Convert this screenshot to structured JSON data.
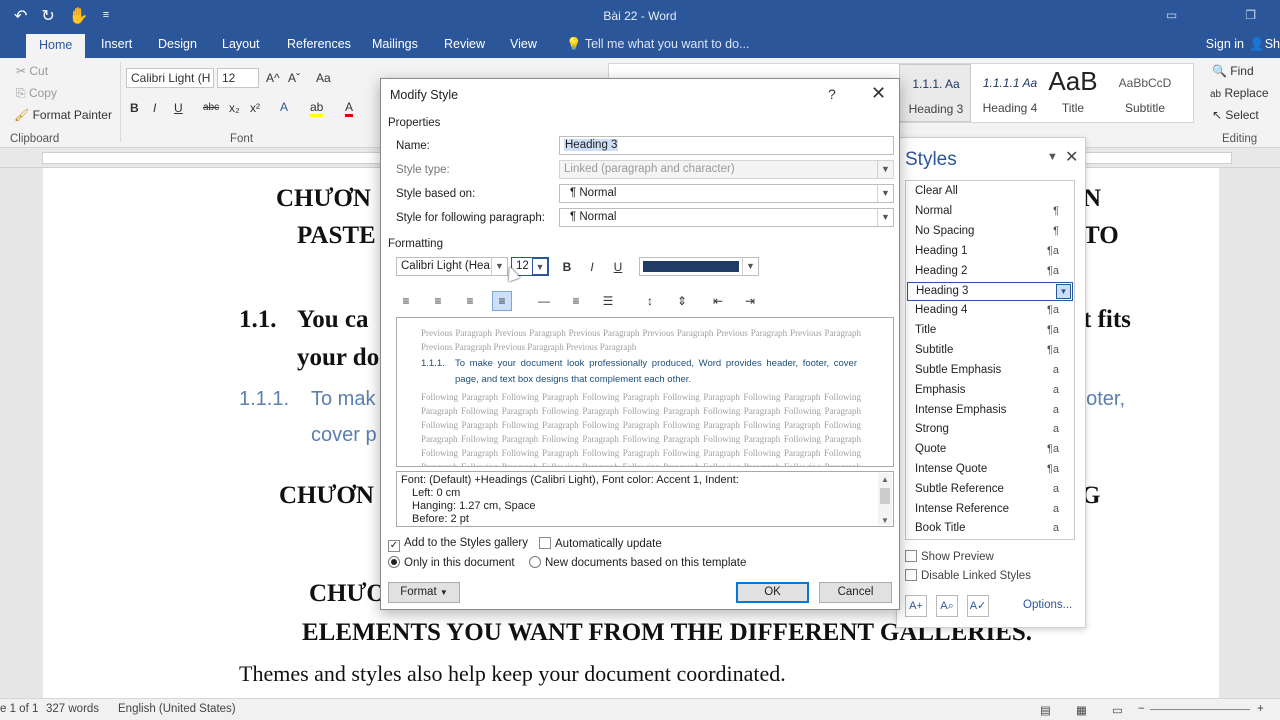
{
  "window": {
    "title": "Bài 22 - Word"
  },
  "tabs": [
    "Home",
    "Insert",
    "Design",
    "Layout",
    "References",
    "Mailings",
    "Review",
    "View"
  ],
  "tell_me": "Tell me what you want to do...",
  "account": {
    "signin": "Sign in",
    "share": "Sh"
  },
  "clipboard": {
    "cut": "Cut",
    "copy": "Copy",
    "format_painter": "Format Painter",
    "label": "Clipboard"
  },
  "font": {
    "family": "Calibri Light (H",
    "size": "12",
    "label": "Font",
    "bold": "B",
    "italic": "I",
    "underline": "U",
    "strike": "abc",
    "sub": "x₂",
    "sup": "x²",
    "case": "Aa",
    "grow": "A^",
    "shrink": "Aˇ"
  },
  "gallery": [
    {
      "preview": "1.1.1.  Aa",
      "name": "Heading 3"
    },
    {
      "preview": "1.1.1.1  Aa",
      "name": "Heading 4"
    },
    {
      "preview": "AaB",
      "name": "Title"
    },
    {
      "preview": "AaBbCcD",
      "name": "Subtitle"
    }
  ],
  "editing": {
    "find": "Find",
    "replace": "Replace",
    "select": "Select",
    "label": "Editing"
  },
  "document": {
    "line1": "CHƯƠN",
    "line1r": "N",
    "line2": "PASTE",
    "line2r": "TO",
    "h2_num": "1.1.",
    "h2_a": "You ca",
    "h2_ar": "t fits",
    "h2_b": "your do",
    "h3_num": "1.1.1.",
    "h3_a": "To mak",
    "h3_ar": "ooter,",
    "h3_b": "cover p",
    "line3": "CHƯƠN",
    "line3r": "G",
    "line4": "CHƯƠ",
    "line5": "ELEMENTS YOU WANT FROM THE DIFFERENT GALLERIES.",
    "body": "Themes and styles also help keep your document coordinated."
  },
  "status": {
    "page": "e 1 of 1",
    "words": "327 words",
    "language": "English (United States)"
  },
  "styles_pane": {
    "title": "Styles",
    "items": [
      {
        "name": "Clear All",
        "sym": ""
      },
      {
        "name": "Normal",
        "sym": "¶"
      },
      {
        "name": "No Spacing",
        "sym": "¶"
      },
      {
        "name": "Heading 1",
        "sym": "¶a"
      },
      {
        "name": "Heading 2",
        "sym": "¶a"
      },
      {
        "name": "Heading 3",
        "sym": "¶a"
      },
      {
        "name": "Heading 4",
        "sym": "¶a"
      },
      {
        "name": "Title",
        "sym": "¶a"
      },
      {
        "name": "Subtitle",
        "sym": "¶a"
      },
      {
        "name": "Subtle Emphasis",
        "sym": "a"
      },
      {
        "name": "Emphasis",
        "sym": "a"
      },
      {
        "name": "Intense Emphasis",
        "sym": "a"
      },
      {
        "name": "Strong",
        "sym": "a"
      },
      {
        "name": "Quote",
        "sym": "¶a"
      },
      {
        "name": "Intense Quote",
        "sym": "¶a"
      },
      {
        "name": "Subtle Reference",
        "sym": "a"
      },
      {
        "name": "Intense Reference",
        "sym": "a"
      },
      {
        "name": "Book Title",
        "sym": "a"
      }
    ],
    "selected": "Heading 3",
    "show_preview": "Show Preview",
    "disable_linked": "Disable Linked Styles",
    "options": "Options..."
  },
  "dialog": {
    "title": "Modify Style",
    "help": "?",
    "properties": "Properties",
    "name_label": "Name:",
    "name_value": "Heading 3",
    "type_label": "Style type:",
    "type_value": "Linked (paragraph and character)",
    "based_label": "Style based on:",
    "based_value": "¶  Normal",
    "following_label": "Style for following paragraph:",
    "following_value": "¶  Normal",
    "formatting": "Formatting",
    "font_family": "Calibri Light (Hea",
    "font_size": "12",
    "bold": "B",
    "italic": "I",
    "underline": "U",
    "font_color": "#1f3b66",
    "preview_prev": "Previous Paragraph Previous Paragraph Previous Paragraph Previous Paragraph Previous Paragraph Previous Paragraph Previous Paragraph Previous Paragraph Previous Paragraph",
    "preview_num": "1.1.1.",
    "preview_text": "To make your document look professionally produced, Word provides header, footer, cover page, and text box designs that complement each other.",
    "preview_follow": "Following Paragraph Following Paragraph Following Paragraph Following Paragraph Following Paragraph Following Paragraph Following Paragraph Following Paragraph Following Paragraph Following Paragraph Following Paragraph Following Paragraph Following Paragraph Following Paragraph Following Paragraph Following Paragraph Following Paragraph Following Paragraph Following Paragraph Following Paragraph Following Paragraph Following Paragraph Following Paragraph Following Paragraph Following Paragraph Following Paragraph Following Paragraph Following Paragraph Following Paragraph Following Paragraph Following Paragraph Following Paragraph Following Paragraph Following Paragraph Following Paragraph",
    "desc_1": "Font: (Default) +Headings (Calibri Light), Font color: Accent 1, Indent:",
    "desc_2": "Left:  0 cm",
    "desc_3": "Hanging:  1.27 cm, Space",
    "desc_4": "Before:  2 pt",
    "add_gallery": "Add to the Styles gallery",
    "auto_update": "Automatically update",
    "only_doc": "Only in this document",
    "new_docs": "New documents based on this template",
    "format_btn": "Format",
    "ok": "OK",
    "cancel": "Cancel"
  }
}
